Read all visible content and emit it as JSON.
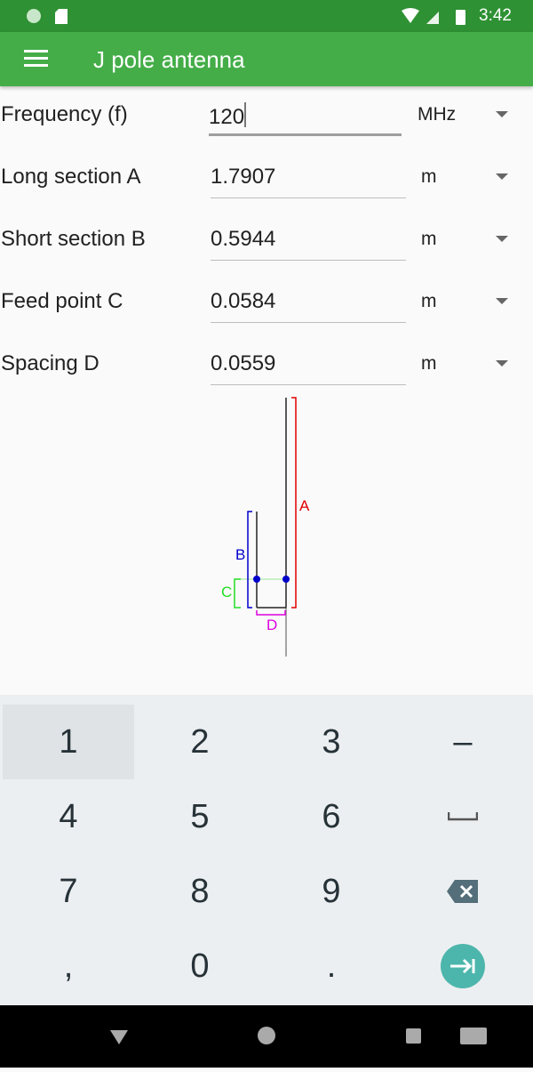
{
  "status_bar": {
    "time": "3:42",
    "icons": [
      "sync-icon",
      "sd-card-icon",
      "wifi-icon",
      "signal-icon",
      "battery-charging-icon"
    ]
  },
  "app_bar": {
    "title": "J pole antenna",
    "menu_icon": "hamburger-menu-icon"
  },
  "fields": [
    {
      "label": "Frequency (f)",
      "value": "120",
      "unit": "MHz"
    },
    {
      "label": "Long section A",
      "value": "1.7907",
      "unit": "m"
    },
    {
      "label": "Short section B",
      "value": "0.5944",
      "unit": "m"
    },
    {
      "label": "Feed point C",
      "value": "0.0584",
      "unit": "m"
    },
    {
      "label": "Spacing D",
      "value": "0.0559",
      "unit": "m"
    }
  ],
  "diagram": {
    "labels": {
      "a": "A",
      "b": "B",
      "c": "C",
      "d": "D"
    },
    "colors": {
      "a": "#e00000",
      "b": "#0000cc",
      "c": "#22dd22",
      "d": "#dd00dd"
    }
  },
  "keyboard": {
    "keys": [
      "1",
      "2",
      "3",
      "–",
      "4",
      "5",
      "6",
      "space",
      "7",
      "8",
      "9",
      "backspace",
      ",",
      "0",
      ".",
      "next"
    ]
  },
  "colors": {
    "status_bar": "#2e9133",
    "app_bar": "#44ad48",
    "accent": "#4db6ac"
  }
}
